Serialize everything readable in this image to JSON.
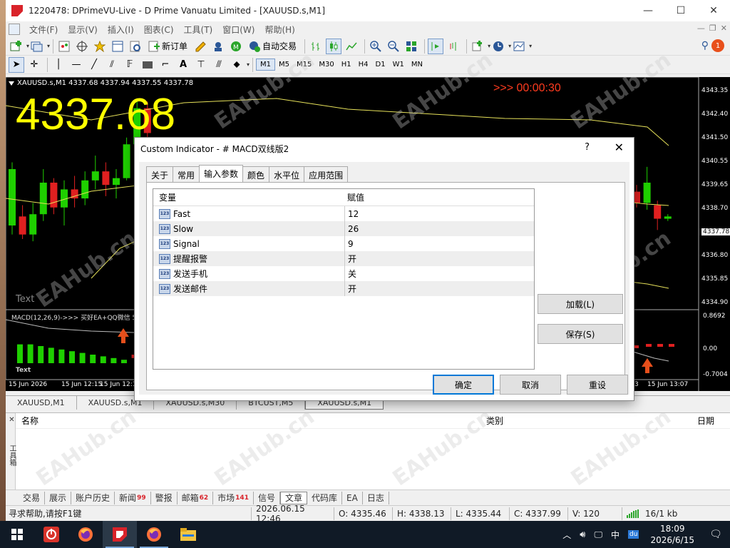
{
  "window": {
    "title": "1220478: DPrimeVU-Live - D Prime Vanuatu Limited - [XAUUSD.s,M1]",
    "controls": {
      "min": "—",
      "max": "☐",
      "close": "✕"
    }
  },
  "menu": [
    "文件(F)",
    "显示(V)",
    "插入(I)",
    "图表(C)",
    "工具(T)",
    "窗口(W)",
    "帮助(H)"
  ],
  "toolbar": {
    "new_order": "新订单",
    "auto_trade": "自动交易",
    "timeframes": [
      "M1",
      "M5",
      "M15",
      "M30",
      "H1",
      "H4",
      "D1",
      "W1",
      "MN"
    ],
    "active_tf": "M1",
    "notif_count": "1"
  },
  "chart": {
    "header": "XAUUSD.s,M1  4337.68 4337.94 4337.55 4337.78",
    "big_price": "4337.68",
    "timer": ">>> 00:00:30",
    "text_label": "Text",
    "price_ticks": [
      "4343.35",
      "4342.40",
      "4341.50",
      "4340.55",
      "4339.65",
      "4338.70",
      "4337.78",
      "4336.80",
      "4335.85",
      "4334.90"
    ],
    "current_price": "4337.78",
    "macd_label": "MACD(12,26,9)->>> 买好EA+QQ微信 5",
    "macd_ticks": [
      "0.8692",
      "0.00",
      "-0.7004"
    ],
    "macd_text": "Text",
    "time_ticks": [
      "15 Jun 2026",
      "15 Jun 12:15",
      "15 Jun 12:1",
      "3",
      "15 Jun 13:07"
    ],
    "candles": [
      {
        "o": 4337.4,
        "c": 4339.9,
        "h": 4340.2,
        "l": 4337.0
      },
      {
        "o": 4337.8,
        "c": 4337.0,
        "h": 4338.3,
        "l": 4336.8
      },
      {
        "o": 4337.0,
        "c": 4337.9,
        "h": 4338.4,
        "l": 4336.7
      },
      {
        "o": 4337.9,
        "c": 4339.3,
        "h": 4339.9,
        "l": 4337.6
      },
      {
        "o": 4339.3,
        "c": 4338.2,
        "h": 4339.5,
        "l": 4337.9
      },
      {
        "o": 4338.2,
        "c": 4339.0,
        "h": 4339.4,
        "l": 4337.4
      },
      {
        "o": 4339.0,
        "c": 4338.6,
        "h": 4339.6,
        "l": 4338.2
      },
      {
        "o": 4338.6,
        "c": 4339.4,
        "h": 4339.8,
        "l": 4338.3
      },
      {
        "o": 4339.4,
        "c": 4339.8,
        "h": 4340.5,
        "l": 4339.0
      },
      {
        "o": 4339.8,
        "c": 4339.2,
        "h": 4340.2,
        "l": 4338.7
      },
      {
        "o": 4339.2,
        "c": 4339.5,
        "h": 4339.9,
        "l": 4338.6
      },
      {
        "o": 4339.5,
        "c": 4341.0,
        "h": 4341.3,
        "l": 4339.4
      },
      {
        "o": 4341.0,
        "c": 4342.6,
        "h": 4343.0,
        "l": 4340.8
      },
      {
        "o": 4342.6,
        "c": 4341.5,
        "h": 4342.9,
        "l": 4341.2
      }
    ],
    "right_candles": [
      {
        "o": 4338.9,
        "c": 4338.4,
        "h": 4339.2,
        "l": 4338.2
      },
      {
        "o": 4338.4,
        "c": 4339.3,
        "h": 4340.0,
        "l": 4338.1
      },
      {
        "o": 4338.3,
        "c": 4337.7,
        "h": 4338.5,
        "l": 4337.2
      },
      {
        "o": 4337.7,
        "c": 4337.8,
        "h": 4337.9,
        "l": 4337.6
      }
    ],
    "macd_hist": [
      0.55,
      0.55,
      0.5,
      0.45,
      0.4,
      0.35,
      0.3,
      0.25,
      0.2,
      0.15,
      0.1,
      -0.1
    ]
  },
  "dialog": {
    "title": "Custom Indicator - # MACD双线版2",
    "help": "?",
    "close": "✕",
    "tabs": [
      "关于",
      "常用",
      "输入参数",
      "颜色",
      "水平位",
      "应用范围"
    ],
    "active_tab": 2,
    "columns": [
      "变量",
      "赋值"
    ],
    "rows": [
      {
        "name": "Fast",
        "value": "12"
      },
      {
        "name": "Slow",
        "value": "26"
      },
      {
        "name": "Signal",
        "value": "9"
      },
      {
        "name": "提醒报警",
        "value": "开"
      },
      {
        "name": "发送手机",
        "value": "关"
      },
      {
        "name": "发送邮件",
        "value": "开"
      }
    ],
    "load": "加载(L)",
    "save": "保存(S)",
    "ok": "确定",
    "cancel": "取消",
    "reset": "重设"
  },
  "chart_tabs": [
    "XAUUSD,M1",
    "XAUUSD.s,M1",
    "XAUUSD.s,M30",
    "BTCUST,M5",
    "XAUUSD.s,M1"
  ],
  "active_chart_tab": 4,
  "terminal": {
    "col_name": "名称",
    "col_category": "类别",
    "col_date": "日期",
    "tabs": [
      {
        "label": "交易",
        "badge": ""
      },
      {
        "label": "展示",
        "badge": ""
      },
      {
        "label": "账户历史",
        "badge": ""
      },
      {
        "label": "新闻",
        "badge": "99"
      },
      {
        "label": "警报",
        "badge": ""
      },
      {
        "label": "邮箱",
        "badge": "62"
      },
      {
        "label": "市场",
        "badge": "141"
      },
      {
        "label": "信号",
        "badge": ""
      },
      {
        "label": "文章",
        "badge": ""
      },
      {
        "label": "代码库",
        "badge": ""
      },
      {
        "label": "EA",
        "badge": ""
      },
      {
        "label": "日志",
        "badge": ""
      }
    ],
    "active_tab": 8,
    "side_label": "工具箱"
  },
  "status": {
    "help": "寻求帮助,请按F1键",
    "datetime": "2026.06.15 12:46",
    "open": "O: 4335.46",
    "high": "H: 4338.13",
    "low": "L: 4335.44",
    "close": "C: 4337.99",
    "volume": "V: 120",
    "net": "16/1 kb"
  },
  "watermark": "EAHub.cn",
  "taskbar": {
    "time": "18:09",
    "date": "2026/6/15",
    "ime": "中",
    "du": "du"
  }
}
